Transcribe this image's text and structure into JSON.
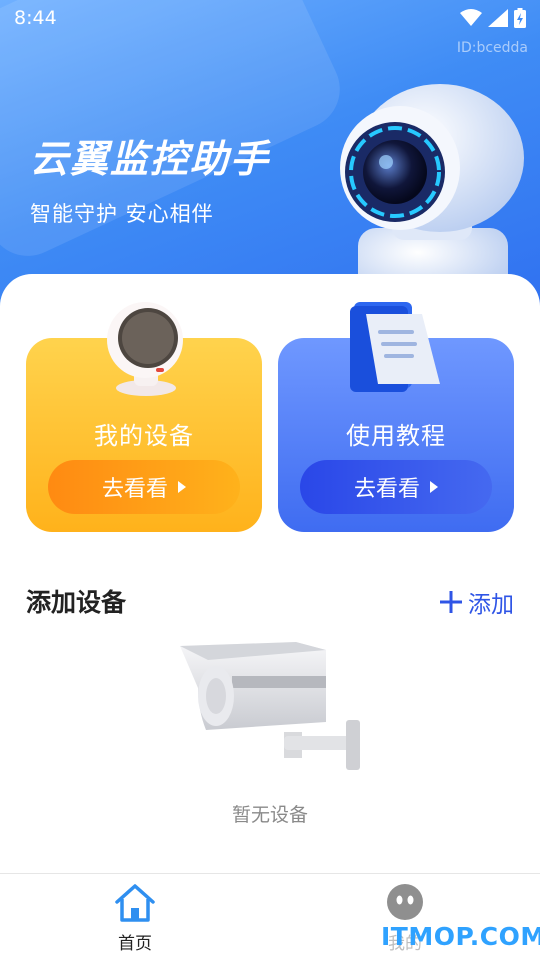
{
  "status_bar": {
    "time": "8:44"
  },
  "header": {
    "device_id": "ID:bcedda",
    "app_title": "云翼监控助手",
    "app_subtitle": "智能守护 安心相伴"
  },
  "cards": [
    {
      "title": "我的设备",
      "button_label": "去看看"
    },
    {
      "title": "使用教程",
      "button_label": "去看看"
    }
  ],
  "add_device_section": {
    "title": "添加设备",
    "add_label": "添加",
    "empty_text": "暂无设备"
  },
  "bottom_nav": {
    "items": [
      {
        "label": "首页",
        "icon": "home-icon",
        "active": true
      },
      {
        "label": "我的",
        "icon": "profile-face-icon",
        "active": false
      }
    ]
  },
  "watermark": "ITMOP.COM",
  "colors": {
    "primary_blue": "#2f55e6",
    "card_orange": "#ffb21b",
    "card_blue": "#4569f0",
    "home_icon": "#2f8ff0"
  }
}
